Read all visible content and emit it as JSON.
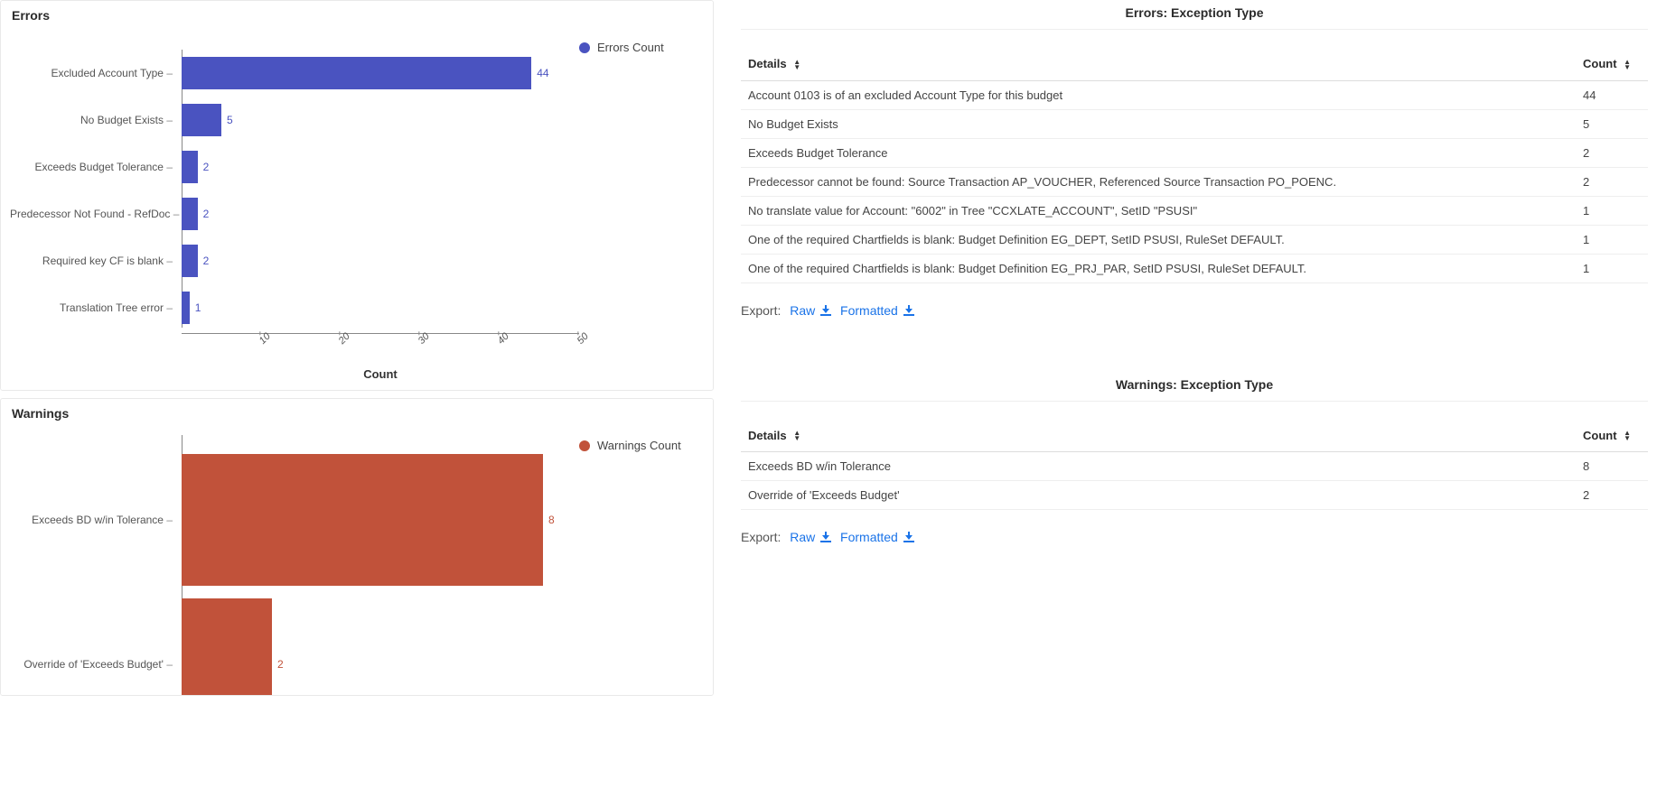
{
  "colors": {
    "errors_bar": "#4a53c0",
    "errors_text": "#4a53c0",
    "warnings_bar": "#c1523a",
    "warnings_text": "#c1523a"
  },
  "charts_panel": {
    "errors": {
      "title": "Errors",
      "legend": "Errors Count",
      "xlabel": "Count"
    },
    "warnings": {
      "title": "Warnings",
      "legend": "Warnings Count"
    }
  },
  "table_headers": {
    "details": "Details",
    "count": "Count"
  },
  "export": {
    "label": "Export:",
    "raw": "Raw",
    "formatted": "Formatted"
  },
  "errors_table": {
    "title": "Errors: Exception Type",
    "rows": [
      {
        "details": "Account 0103 is of an excluded Account Type for this budget",
        "count": 44
      },
      {
        "details": "No Budget Exists",
        "count": 5
      },
      {
        "details": "Exceeds Budget Tolerance",
        "count": 2
      },
      {
        "details": "Predecessor cannot be found: Source Transaction AP_VOUCHER, Referenced Source Transaction PO_POENC.",
        "count": 2
      },
      {
        "details": "No translate value for Account: \"6002\" in Tree \"CCXLATE_ACCOUNT\", SetID \"PSUSI\"",
        "count": 1
      },
      {
        "details": "One of the required Chartfields is blank: Budget Definition EG_DEPT, SetID PSUSI, RuleSet DEFAULT.",
        "count": 1
      },
      {
        "details": "One of the required Chartfields is blank: Budget Definition EG_PRJ_PAR, SetID PSUSI, RuleSet DEFAULT.",
        "count": 1
      }
    ]
  },
  "warnings_table": {
    "title": "Warnings: Exception Type",
    "rows": [
      {
        "details": "Exceeds BD w/in Tolerance",
        "count": 8
      },
      {
        "details": "Override of 'Exceeds Budget'",
        "count": 2
      }
    ]
  },
  "chart_data": [
    {
      "type": "bar",
      "orientation": "horizontal",
      "title": "Errors",
      "xlabel": "Count",
      "xlim": [
        0,
        50
      ],
      "ticks": [
        10,
        20,
        30,
        40,
        50
      ],
      "series": [
        {
          "name": "Errors Count",
          "color": "#4a53c0"
        }
      ],
      "categories": [
        "Excluded Account Type",
        "No Budget Exists",
        "Exceeds Budget Tolerance",
        "Predecessor Not Found - RefDoc",
        "Required key CF is blank",
        "Translation Tree error"
      ],
      "values": [
        44,
        5,
        2,
        2,
        2,
        1
      ]
    },
    {
      "type": "bar",
      "orientation": "horizontal",
      "title": "Warnings",
      "series": [
        {
          "name": "Warnings Count",
          "color": "#c1523a"
        }
      ],
      "categories": [
        "Exceeds BD w/in Tolerance",
        "Override of 'Exceeds Budget'"
      ],
      "values": [
        8,
        2
      ]
    }
  ]
}
